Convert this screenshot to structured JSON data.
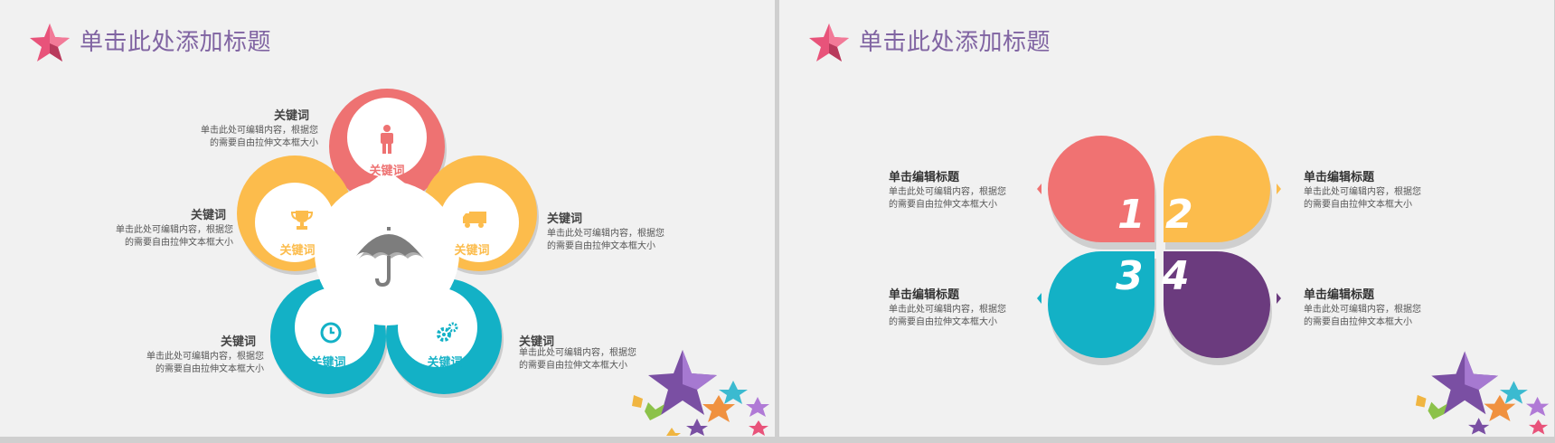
{
  "left_slide": {
    "title": "单击此处添加标题",
    "center_icon": "umbrella-icon",
    "petals": [
      {
        "label": "关键词",
        "icon": "person-icon",
        "color": "#ee7272"
      },
      {
        "label": "关键词",
        "icon": "trophy-icon",
        "color": "#fcbc4c"
      },
      {
        "label": "关键词",
        "icon": "truck-icon",
        "color": "#fcbc4c"
      },
      {
        "label": "关键词",
        "icon": "clock-icon",
        "color": "#13b1c6"
      },
      {
        "label": "关键词",
        "icon": "gears-icon",
        "color": "#13b1c6"
      }
    ],
    "callouts": [
      {
        "keyword": "关键词",
        "line1": "单击此处可编辑内容，根据您",
        "line2": "的需要自由拉伸文本框大小"
      },
      {
        "keyword": "关键词",
        "line1": "单击此处可编辑内容，根据您",
        "line2": "的需要自由拉伸文本框大小"
      },
      {
        "keyword": "关键词",
        "line1": "单击此处可编辑内容，根据您",
        "line2": "的需要自由拉伸文本框大小"
      },
      {
        "keyword": "关键词",
        "line1": "单击此处可编辑内容，根据您",
        "line2": "的需要自由拉伸文本框大小"
      },
      {
        "keyword": "关键词",
        "line1": "单击此处可编辑内容，根据您",
        "line2": "的需要自由拉伸文本框大小"
      }
    ]
  },
  "right_slide": {
    "title": "单击此处添加标题",
    "leaves": [
      {
        "number": "1",
        "color": "#f07272"
      },
      {
        "number": "2",
        "color": "#fcbc4c"
      },
      {
        "number": "3",
        "color": "#13b1c6"
      },
      {
        "number": "4",
        "color": "#6b3b7e"
      }
    ],
    "callouts": [
      {
        "heading": "单击编辑标题",
        "line1": "单击此处可编辑内容，根据您",
        "line2": "的需要自由拉伸文本框大小"
      },
      {
        "heading": "单击编辑标题",
        "line1": "单击此处可编辑内容，根据您",
        "line2": "的需要自由拉伸文本框大小"
      },
      {
        "heading": "单击编辑标题",
        "line1": "单击此处可编辑内容，根据您",
        "line2": "的需要自由拉伸文本框大小"
      },
      {
        "heading": "单击编辑标题",
        "line1": "单击此处可编辑内容，根据您",
        "line2": "的需要自由拉伸文本框大小"
      }
    ]
  },
  "colors": {
    "title": "#8064a2",
    "pink_star": "#e8537a",
    "purple_star": "#7a4fa3"
  }
}
